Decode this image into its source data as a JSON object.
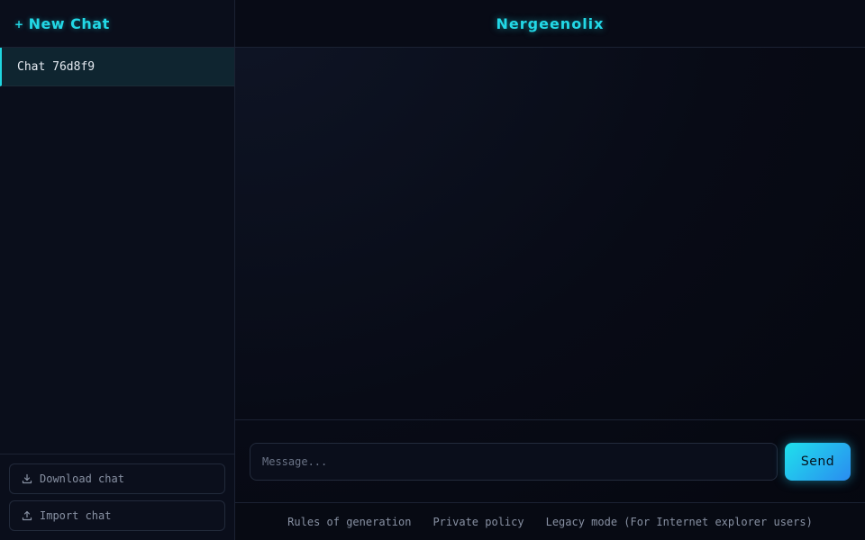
{
  "sidebar": {
    "new_chat_icon": "+",
    "new_chat_label": "New Chat",
    "chats": [
      {
        "label": "Chat 76d8f9",
        "active": true
      }
    ],
    "download_label": "Download chat",
    "download_icon": "download-icon",
    "import_label": "Import chat",
    "import_icon": "upload-icon"
  },
  "header": {
    "title": "Nergeenolix"
  },
  "composer": {
    "placeholder": "Message...",
    "value": "",
    "send_label": "Send"
  },
  "footer": {
    "links": [
      "Rules of generation",
      "Private policy",
      "Legacy mode (For Internet explorer users)"
    ]
  },
  "colors": {
    "accent": "#22d8e6",
    "background": "#070a13",
    "sidebar_bg": "#0a0e1b",
    "active_chat_bg": "#0f2530",
    "send_gradient_start": "#1fe0ec",
    "send_gradient_end": "#2a8cf0",
    "muted_text": "#8891a3"
  }
}
